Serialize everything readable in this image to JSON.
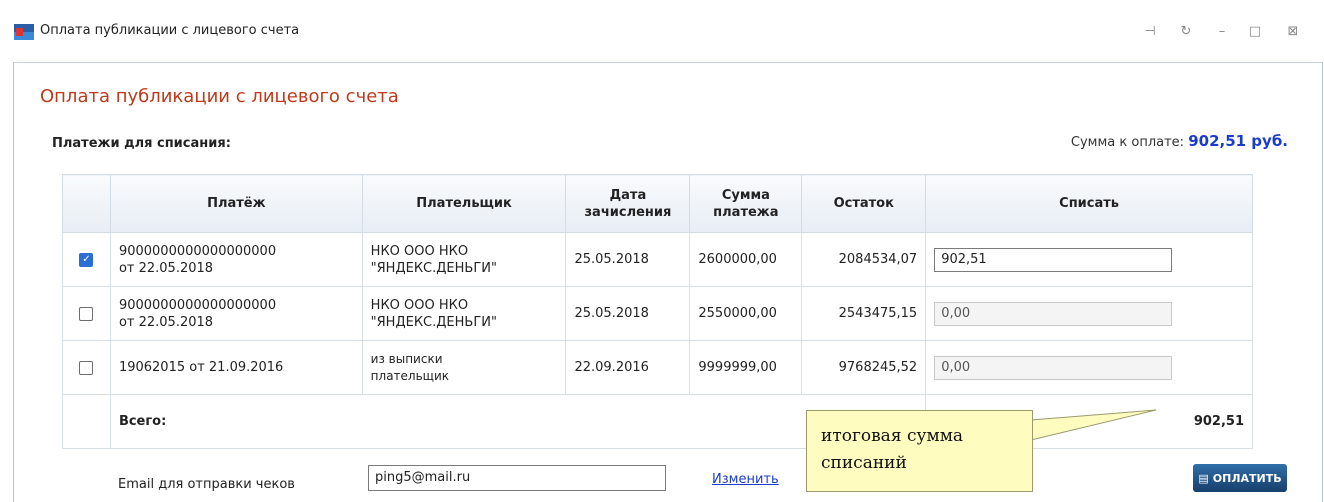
{
  "window": {
    "title": "Оплата публикации с лицевого счета"
  },
  "page": {
    "title": "Оплата публикации с лицевого счета",
    "payments_label": "Платежи для списания:",
    "sum_label": "Сумма к оплате:",
    "sum_value": "902,51 руб."
  },
  "table": {
    "headers": {
      "payment": "Платёж",
      "payer": "Плательщик",
      "date_line1": "Дата",
      "date_line2": "зачисления",
      "amount_line1": "Сумма",
      "amount_line2": "платежа",
      "balance": "Остаток",
      "writeoff": "Списать"
    },
    "rows": [
      {
        "checked": true,
        "payment_line1": "9000000000000000000",
        "payment_line2": "от 22.05.2018",
        "payer_line1": "НКО ООО НКО",
        "payer_line2": "\"ЯНДЕКС.ДЕНЬГИ\"",
        "date": "25.05.2018",
        "amount": "2600000,00",
        "balance": "2084534,07",
        "writeoff": "902,51",
        "enabled": true
      },
      {
        "checked": false,
        "payment_line1": "9000000000000000000",
        "payment_line2": "от 22.05.2018",
        "payer_line1": "НКО ООО НКО",
        "payer_line2": "\"ЯНДЕКС.ДЕНЬГИ\"",
        "date": "25.05.2018",
        "amount": "2550000,00",
        "balance": "2543475,15",
        "writeoff": "0,00",
        "enabled": false
      },
      {
        "checked": false,
        "payment_line1": "19062015 от 21.09.2016",
        "payment_line2": "",
        "payer_line1": "из выписки",
        "payer_line2": "плательщик",
        "date": "22.09.2016",
        "amount": "9999999,00",
        "balance": "9768245,52",
        "writeoff": "0,00",
        "enabled": false
      }
    ],
    "total_label": "Всего:",
    "total_value": "902,51"
  },
  "email": {
    "label": "Email для отправки чеков",
    "value": "ping5@mail.ru",
    "change_link": "Изменить"
  },
  "pay_button": "ОПЛАТИТЬ",
  "callout": {
    "line1": "итоговая сумма",
    "line2": "списаний"
  }
}
